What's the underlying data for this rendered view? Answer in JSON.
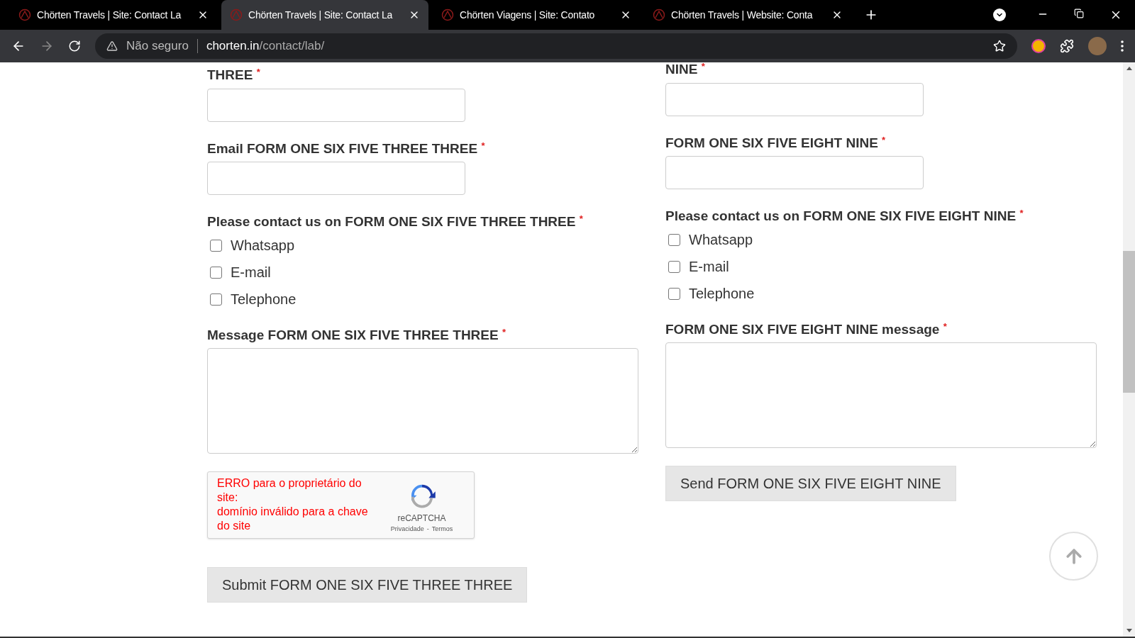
{
  "browser": {
    "tabs": [
      {
        "title": "Chörten Travels | Site: Contact La",
        "selected": false
      },
      {
        "title": "Chörten Travels | Site: Contact La",
        "selected": true
      },
      {
        "title": "Chörten Viagens | Site: Contato",
        "selected": false
      },
      {
        "title": "Chörten Travels | Website: Conta",
        "selected": false
      }
    ],
    "address": {
      "security": "Não seguro",
      "host": "chorten.in",
      "path": "/contact/lab/"
    }
  },
  "forms": [
    {
      "fields": [
        {
          "kind": "text",
          "label": "THREE",
          "required_mark": "*"
        },
        {
          "kind": "text",
          "label": "Email FORM ONE SIX FIVE THREE THREE",
          "required_mark": "*"
        },
        {
          "kind": "checkboxes",
          "label": "Please contact us on FORM ONE SIX FIVE THREE THREE",
          "required_mark": "*",
          "options": [
            {
              "label": "Whatsapp",
              "checked": false
            },
            {
              "label": "E-mail",
              "checked": false
            },
            {
              "label": "Telephone",
              "checked": false
            }
          ]
        },
        {
          "kind": "textarea",
          "label": "Message FORM ONE SIX FIVE THREE THREE",
          "required_mark": "*"
        }
      ],
      "captcha": {
        "error_lines": [
          "ERRO para o proprietário do site:",
          "domínio inválido para a chave do site"
        ],
        "brand": "reCAPTCHA",
        "privacy": "Privacidade",
        "separator": "-",
        "terms": "Termos"
      },
      "submit": "Submit FORM ONE SIX FIVE THREE THREE"
    },
    {
      "fields": [
        {
          "kind": "text",
          "label": "NINE",
          "required_mark": "*"
        },
        {
          "kind": "text",
          "label": "FORM ONE SIX FIVE EIGHT NINE",
          "required_mark": "*"
        },
        {
          "kind": "checkboxes",
          "label": "Please contact us on FORM ONE SIX FIVE EIGHT NINE",
          "required_mark": "*",
          "options": [
            {
              "label": "Whatsapp",
              "checked": false
            },
            {
              "label": "E-mail",
              "checked": false
            },
            {
              "label": "Telephone",
              "checked": false
            }
          ]
        },
        {
          "kind": "textarea",
          "label": "FORM ONE SIX FIVE EIGHT NINE message",
          "required_mark": "*"
        }
      ],
      "submit": "Send FORM ONE SIX FIVE EIGHT NINE"
    }
  ]
}
